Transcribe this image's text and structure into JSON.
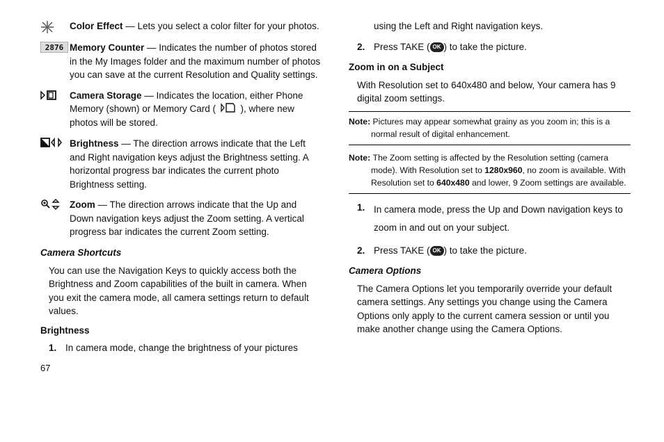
{
  "leftColumn": {
    "items": [
      {
        "icon": "color-effect-icon",
        "title": "Color Effect",
        "body": " — Lets you select a color filter for your photos."
      },
      {
        "icon": "memory-counter-icon",
        "title": "Memory Counter",
        "body": " — Indicates the number of photos stored in the My Images folder and the maximum number of photos you can save at the current Resolution and Quality settings."
      },
      {
        "icon": "camera-storage-icon",
        "title": "Camera Storage",
        "bodyBefore": " — Indicates the location, either Phone Memory (shown) or Memory Card ( ",
        "bodyAfter": " ), where new photos will be stored."
      },
      {
        "icon": "brightness-icon",
        "title": "Brightness",
        "body": " — The direction arrows indicate that the Left and Right navigation keys adjust the Brightness setting. A horizontal progress bar indicates the current photo Brightness setting."
      },
      {
        "icon": "zoom-icon",
        "title": "Zoom",
        "body": " — The direction arrows indicate that the Up and Down navigation keys adjust the Zoom setting. A vertical progress bar indicates the current Zoom setting."
      }
    ],
    "shortcutsHeading": "Camera Shortcuts",
    "shortcutsBody": "You can use the Navigation Keys to quickly access both the Brightness and Zoom capabilities of the built in camera. When you exit the camera mode, all camera settings return to default values.",
    "brightnessHeading": "Brightness",
    "brightnessStep1": "In camera mode, change the brightness of your pictures"
  },
  "rightColumn": {
    "continuedLine": "using the Left and Right navigation keys.",
    "step2before": "Press ",
    "step2take": "TAKE",
    "step2paren1": " (",
    "step2ok": "OK",
    "step2paren2": ") to take the picture.",
    "zoomHeading": "Zoom in on a Subject",
    "zoomBody1": "With Resolution set to ",
    "zoomRes": "640x480",
    "zoomBody2": " and below, Your camera has 9 digital zoom settings.",
    "note1Label": "Note: ",
    "note1Body": "Pictures may appear somewhat grainy as you zoom in; this is a normal result of digital enhancement.",
    "note2Label": "Note: ",
    "note2Body1": "The Zoom setting is affected by the Resolution setting (camera mode). With Resolution set to ",
    "note2Res1": "1280x960",
    "note2Body2": ", no zoom is available. With Resolution set to ",
    "note2Res2": "640x480",
    "note2Body3": " and lower, 9 Zoom settings are available.",
    "zoomStep1": "In camera mode, press the Up and Down navigation keys to zoom in and out on your subject.",
    "optionsHeading": "Camera Options",
    "optionsBody": "The Camera Options let you temporarily override your default camera settings. Any settings you change using the Camera Options only apply to the current camera session or until you make another change using the Camera Options."
  },
  "pageNumber": "67"
}
